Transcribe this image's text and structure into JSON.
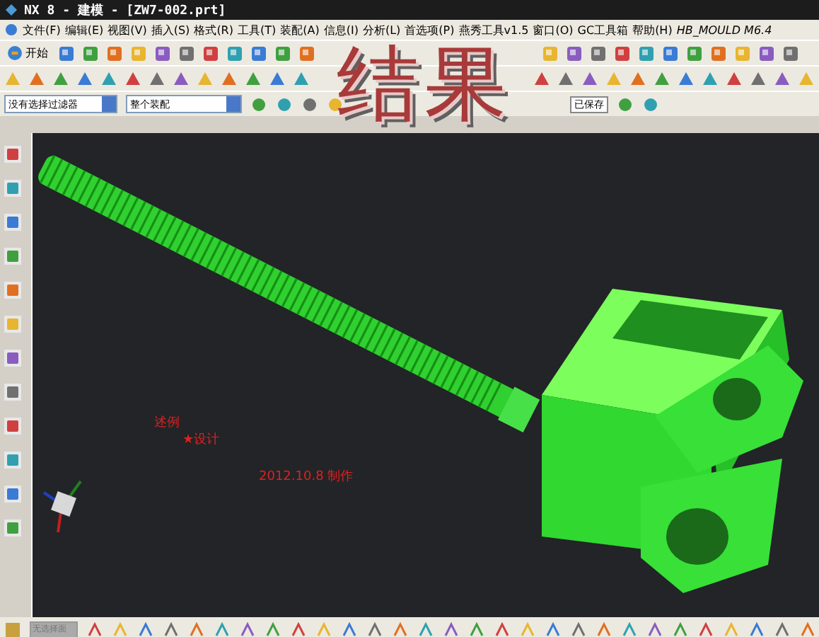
{
  "window": {
    "title": "NX 8 - 建模 - [ZW7-002.prt]"
  },
  "menu": [
    "文件(F)",
    "编辑(E)",
    "视图(V)",
    "插入(S)",
    "格式(R)",
    "工具(T)",
    "装配(A)",
    "信息(I)",
    "分析(L)",
    "首选项(P)",
    "燕秀工具v1.5",
    "窗口(O)",
    "GC工具箱",
    "帮助(H)",
    "HB_MOULD M6.4"
  ],
  "start_button": {
    "label": "开始"
  },
  "selection_bar": {
    "filter": "没有选择过滤器",
    "scope": "整个装配"
  },
  "overlay_title": "结果",
  "save_status": "已保存",
  "viewport_notes": [
    {
      "text": "述例"
    },
    {
      "text": "★设计"
    },
    {
      "text": "2012.10.8 制作"
    }
  ],
  "bottom_toolbar": {
    "field_placeholder": "无选择面"
  }
}
